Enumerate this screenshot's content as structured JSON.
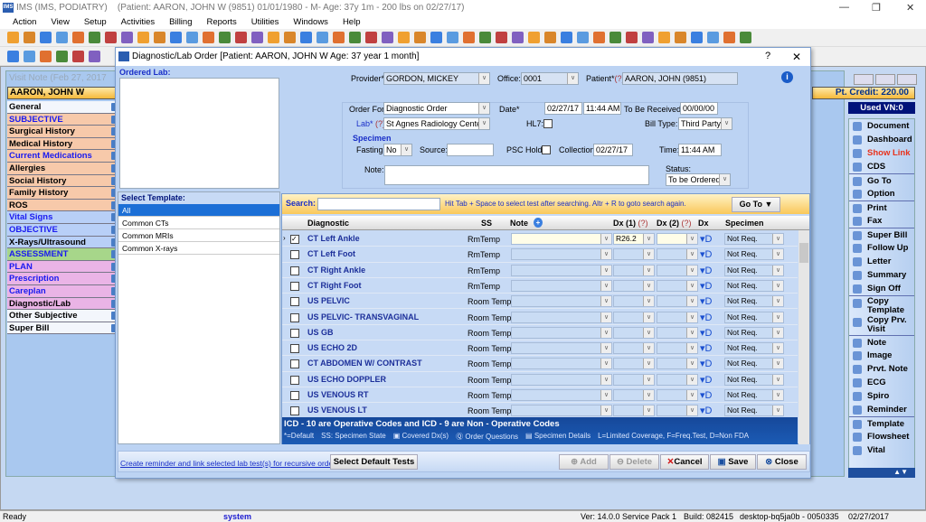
{
  "app": {
    "title": "IMS (IMS, PODIATRY)",
    "patient_info": "(Patient: AARON, JOHN W (9851) 01/01/1980 - M- Age: 37y 1m - 200 lbs on 02/27/17)",
    "logo_text": "IMS"
  },
  "menu": [
    "Action",
    "View",
    "Setup",
    "Activities",
    "Billing",
    "Reports",
    "Utilities",
    "Windows",
    "Help"
  ],
  "visit_note": {
    "title": "Visit Note (Feb 27, 2017",
    "patient_name": "AARON, JOHN W",
    "pt_credit": "Pt. Credit: 220.00",
    "used_vn": "Used VN:0",
    "sections": [
      {
        "label": "General",
        "bg": "#f3f6fc",
        "color": "#000"
      },
      {
        "label": "SUBJECTIVE",
        "bg": "#f7c9aa",
        "color": "#1a1af0"
      },
      {
        "label": "Surgical History",
        "bg": "#f7c9aa",
        "color": "#000"
      },
      {
        "label": "Medical History",
        "bg": "#f7c9aa",
        "color": "#000"
      },
      {
        "label": "Current Medications",
        "bg": "#f7c9aa",
        "color": "#1a1af0"
      },
      {
        "label": "Allergies",
        "bg": "#f7c9aa",
        "color": "#000"
      },
      {
        "label": "Social History",
        "bg": "#f7c9aa",
        "color": "#000"
      },
      {
        "label": "Family History",
        "bg": "#f7c9aa",
        "color": "#000"
      },
      {
        "label": "ROS",
        "bg": "#f7c9aa",
        "color": "#000"
      },
      {
        "label": "Vital Signs",
        "bg": "#b8cff7",
        "color": "#1a1af0"
      },
      {
        "label": "OBJECTIVE",
        "bg": "#b8cff7",
        "color": "#1a1af0"
      },
      {
        "label": "X-Rays/Ultrasound",
        "bg": "#b8cff7",
        "color": "#000"
      },
      {
        "label": "ASSESSMENT",
        "bg": "#a7d68a",
        "color": "#1a1af0"
      },
      {
        "label": "PLAN",
        "bg": "#eab4e6",
        "color": "#1a1af0"
      },
      {
        "label": "Prescription",
        "bg": "#eab4e6",
        "color": "#1a1af0"
      },
      {
        "label": "Careplan",
        "bg": "#eab4e6",
        "color": "#1a1af0"
      },
      {
        "label": "Diagnostic/Lab",
        "bg": "#eab4e6",
        "color": "#000"
      },
      {
        "label": "Other Subjective",
        "bg": "#f3f6fc",
        "color": "#000"
      },
      {
        "label": "Super Bill",
        "bg": "#f3f6fc",
        "color": "#000"
      }
    ],
    "right_panel": [
      {
        "label": "Document",
        "icon": "document-icon"
      },
      {
        "label": "Dashboard",
        "icon": "dashboard-icon"
      },
      {
        "label": "Show Link",
        "icon": "link-icon",
        "color": "#e8321c"
      },
      {
        "label": "CDS",
        "icon": "cds-icon"
      },
      {
        "label": "Go To",
        "icon": "triangle-down-icon",
        "sep": true
      },
      {
        "label": "Option",
        "icon": "triangle-down-icon"
      },
      {
        "label": "Print",
        "icon": "print-icon",
        "sep": true
      },
      {
        "label": "Fax",
        "icon": "fax-icon"
      },
      {
        "label": "Super Bill",
        "icon": "superbill-icon",
        "sep": true
      },
      {
        "label": "Follow Up",
        "icon": "calendar-icon"
      },
      {
        "label": "Letter",
        "icon": "letter-icon"
      },
      {
        "label": "Summary",
        "icon": "summary-icon"
      },
      {
        "label": "Sign Off",
        "icon": "signoff-icon"
      },
      {
        "label": "Copy Template",
        "icon": "copy-icon",
        "sep": true,
        "two": true
      },
      {
        "label": "Copy Prv. Visit",
        "icon": "copy-icon",
        "two": true
      },
      {
        "label": "Note",
        "icon": "note-icon",
        "sep": true
      },
      {
        "label": "Image",
        "icon": "image-icon"
      },
      {
        "label": "Prvt. Note",
        "icon": "note-icon"
      },
      {
        "label": "ECG",
        "icon": "ecg-icon"
      },
      {
        "label": "Spiro",
        "icon": "spiro-icon"
      },
      {
        "label": "Reminder",
        "icon": "reminder-icon"
      },
      {
        "label": "Template",
        "icon": "template-icon",
        "sep": true
      },
      {
        "label": "Flowsheet",
        "icon": "flowsheet-icon"
      },
      {
        "label": "Vital",
        "icon": "vital-icon"
      }
    ]
  },
  "dialog": {
    "title": "Diagnostic/Lab Order  [Patient: AARON, JOHN W  Age: 37 year 1 month]",
    "help": "?",
    "close": "✕",
    "ordered_lab_label": "Ordered Lab:",
    "form": {
      "provider_label": "Provider*",
      "provider": "GORDON, MICKEY",
      "office_label": "Office:",
      "office": "0001",
      "patient_label": "Patient*",
      "patient_q": "(?)",
      "patient": "AARON, JOHN  (9851)",
      "order_for_label": "Order For*",
      "order_for": "Diagnostic Order",
      "date_label": "Date*",
      "date": "02/27/17",
      "time": "11:44 AM",
      "to_be_received_label": "To Be Received:",
      "to_be_received": "00/00/00",
      "lab_label": "Lab*",
      "lab_q": "(?)",
      "lab": "St Agnes Radiology Center",
      "hl7_label": "HL7:",
      "bill_type_label": "Bill Type:",
      "bill_type": "Third Party",
      "specimen_label": "Specimen",
      "fasting_label": "Fasting:",
      "fasting": "No",
      "source_label": "Source:",
      "source": "",
      "psc_hold_label": "PSC Hold:",
      "collection_label": "Collection:",
      "collection": "02/27/17",
      "time_label": "Time:",
      "collection_time": "11:44 AM",
      "note_label": "Note:",
      "note": "",
      "status_label": "Status:",
      "status": "To be Ordered"
    },
    "templates_label": "Select Template:",
    "templates": [
      "All",
      "Common CTs",
      "Common MRIs",
      "Common X-rays"
    ],
    "search_label": "Search:",
    "search_value": "",
    "search_hint": "Hit Tab + Space to select test after searching. Altr + R to goto search again.",
    "goto_label": "Go To",
    "columns": {
      "diagnostic": "Diagnostic",
      "ss": "SS",
      "note": "Note",
      "dx1": "Dx (1)",
      "dx1_q": "(?)",
      "dx2": "Dx (2)",
      "dx2_q": "(?)",
      "dx": "Dx",
      "specimen": "Specimen"
    },
    "rows": [
      {
        "name": "CT Left Ankle",
        "ss": "RmTemp",
        "checked": true,
        "dx1": "R26.2",
        "specimen": "Not Req."
      },
      {
        "name": "CT Left Foot",
        "ss": "RmTemp",
        "checked": false,
        "dx1": "",
        "specimen": "Not Req."
      },
      {
        "name": "CT Right Ankle",
        "ss": "RmTemp",
        "checked": false,
        "dx1": "",
        "specimen": "Not Req."
      },
      {
        "name": "CT Right Foot",
        "ss": "RmTemp",
        "checked": false,
        "dx1": "",
        "specimen": "Not Req."
      },
      {
        "name": "US PELVIC",
        "ss": "Room Temp.",
        "checked": false,
        "dx1": "",
        "specimen": "Not Req."
      },
      {
        "name": "US PELVIC- TRANSVAGINAL",
        "ss": "Room Temp.",
        "checked": false,
        "dx1": "",
        "specimen": "Not Req."
      },
      {
        "name": "US GB",
        "ss": "Room Temp.",
        "checked": false,
        "dx1": "",
        "specimen": "Not Req."
      },
      {
        "name": "US ECHO 2D",
        "ss": "Room Temp.",
        "checked": false,
        "dx1": "",
        "specimen": "Not Req."
      },
      {
        "name": "CT ABDOMEN W/ CONTRAST",
        "ss": "Room Temp.",
        "checked": false,
        "dx1": "",
        "specimen": "Not Req."
      },
      {
        "name": "US ECHO DOPPLER",
        "ss": "Room Temp.",
        "checked": false,
        "dx1": "",
        "specimen": "Not Req."
      },
      {
        "name": "US VENOUS RT",
        "ss": "Room Temp.",
        "checked": false,
        "dx1": "",
        "specimen": "Not Req."
      },
      {
        "name": "US VENOUS LT",
        "ss": "Room Temp.",
        "checked": false,
        "dx1": "",
        "specimen": "Not Req."
      }
    ],
    "footer_title": "ICD - 10 are Operative Codes and ICD - 9 are Non - Operative Codes",
    "legend": {
      "default": "*=Default",
      "ss": "SS: Specimen State",
      "covered": "Covered Dx(s)",
      "questions": "Order Questions",
      "specimen_details": "Specimen Details",
      "coverage": "L=Limited Coverage, F=Freq.Test, D=Non FDA"
    },
    "reminder_link": "Create reminder and link selected lab test(s) for recursive order.",
    "buttons": {
      "select_default": "Select Default Tests",
      "add": "Add",
      "delete": "Delete",
      "cancel": "Cancel",
      "save": "Save",
      "close": "Close"
    }
  },
  "status_bar": {
    "ready": "Ready",
    "user": "system",
    "version": "Ver: 14.0.0 Service Pack 1",
    "build": "Build: 082415",
    "machine": "desktop-bq5ja0b - 0050335",
    "date": "02/27/2017"
  }
}
